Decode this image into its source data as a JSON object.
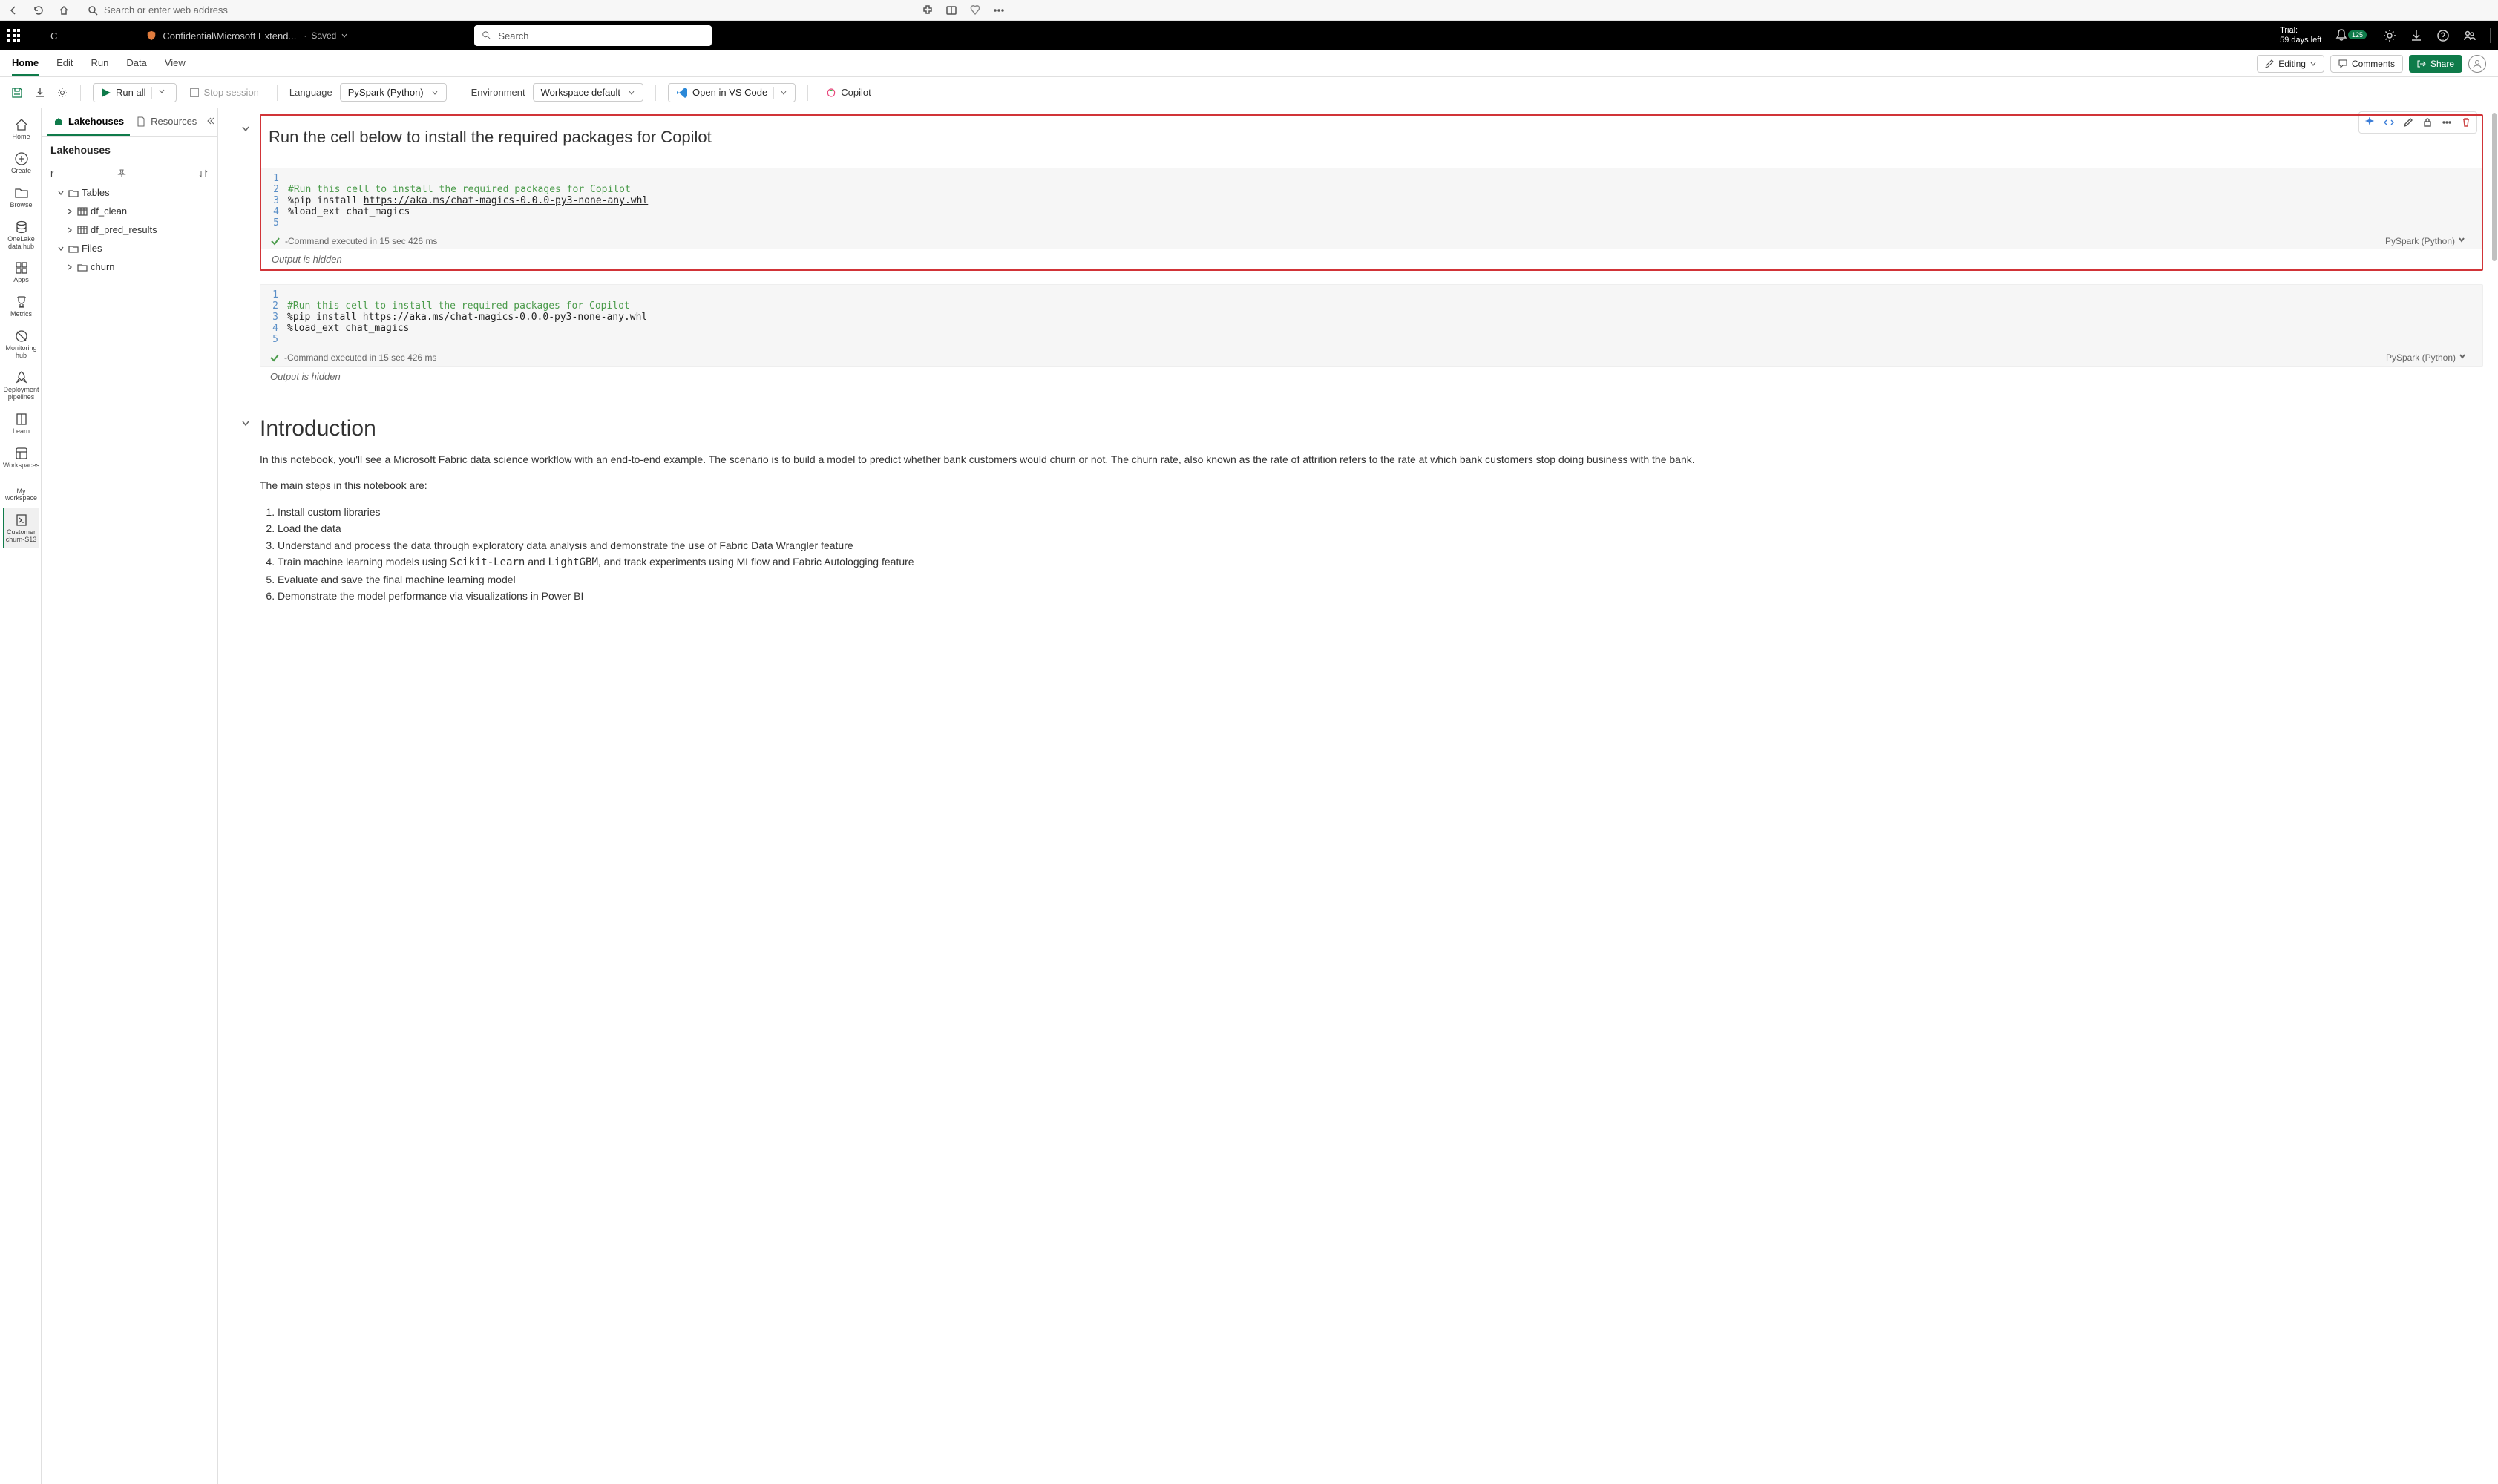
{
  "browser": {
    "placeholder": "Search or enter web address"
  },
  "header": {
    "crumb_letter": "C",
    "breadcrumb": "Confidential\\Microsoft Extend...",
    "saved_label": "Saved",
    "search_placeholder": "Search",
    "trial_line1": "Trial:",
    "trial_line2": "59 days left",
    "notif_badge": "125"
  },
  "ribbon": {
    "tabs": [
      "Home",
      "Edit",
      "Run",
      "Data",
      "View"
    ],
    "editing": "Editing",
    "comments": "Comments",
    "share": "Share"
  },
  "toolbar": {
    "run_all": "Run all",
    "stop": "Stop session",
    "language_lbl": "Language",
    "language_val": "PySpark (Python)",
    "env_lbl": "Environment",
    "env_val": "Workspace default",
    "vscode": "Open in VS Code",
    "copilot": "Copilot"
  },
  "left_rail": [
    {
      "label": "Home",
      "icon": "home"
    },
    {
      "label": "Create",
      "icon": "plus-circle"
    },
    {
      "label": "Browse",
      "icon": "folder"
    },
    {
      "label": "OneLake data hub",
      "icon": "db"
    },
    {
      "label": "Apps",
      "icon": "apps"
    },
    {
      "label": "Metrics",
      "icon": "trophy"
    },
    {
      "label": "Monitoring hub",
      "icon": "eye-off"
    },
    {
      "label": "Deployment pipelines",
      "icon": "rocket"
    },
    {
      "label": "Learn",
      "icon": "book"
    },
    {
      "label": "Workspaces",
      "icon": "workspaces"
    }
  ],
  "rail_extra": {
    "my_workspace": "My workspace",
    "active": "Customer churn-S13"
  },
  "explorer": {
    "tab1": "Lakehouses",
    "tab2": "Resources",
    "header": "Lakehouses",
    "r_label": "r",
    "nodes": {
      "tables": "Tables",
      "df_clean": "df_clean",
      "df_pred": "df_pred_results",
      "files": "Files",
      "churn": "churn"
    }
  },
  "notebook": {
    "md_title": "Run the cell below to install the required packages for Copilot",
    "code_lines": [
      "",
      "#Run this cell to install the required packages for Copilot",
      "%pip install https://aka.ms/chat-magics-0.0.0-py3-none-any.whl",
      "%load_ext chat_magics",
      ""
    ],
    "pip_prefix": "%pip install ",
    "pip_url": "https://aka.ms/chat-magics-0.0.0-py3-none-any.whl",
    "status_text": " -Command executed in 15 sec 426 ms",
    "status_lang": "PySpark (Python)",
    "output_hidden": "Output is hidden",
    "intro_title": "Introduction",
    "intro_p1": "In this notebook, you'll see a Microsoft Fabric data science workflow with an end-to-end example. The scenario is to build a model to predict whether bank customers would churn or not. The churn rate, also known as the rate of attrition refers to the rate at which bank customers stop doing business with the bank.",
    "intro_p2": "The main steps in this notebook are:",
    "steps": [
      "Install custom libraries",
      "Load the data",
      "Understand and process the data through exploratory data analysis and demonstrate the use of Fabric Data Wrangler feature",
      "Train machine learning models using Scikit-Learn and LightGBM, and track experiments using MLflow and Fabric Autologging feature",
      "Evaluate and save the final machine learning model",
      "Demonstrate the model performance via visualizations in Power BI"
    ]
  }
}
